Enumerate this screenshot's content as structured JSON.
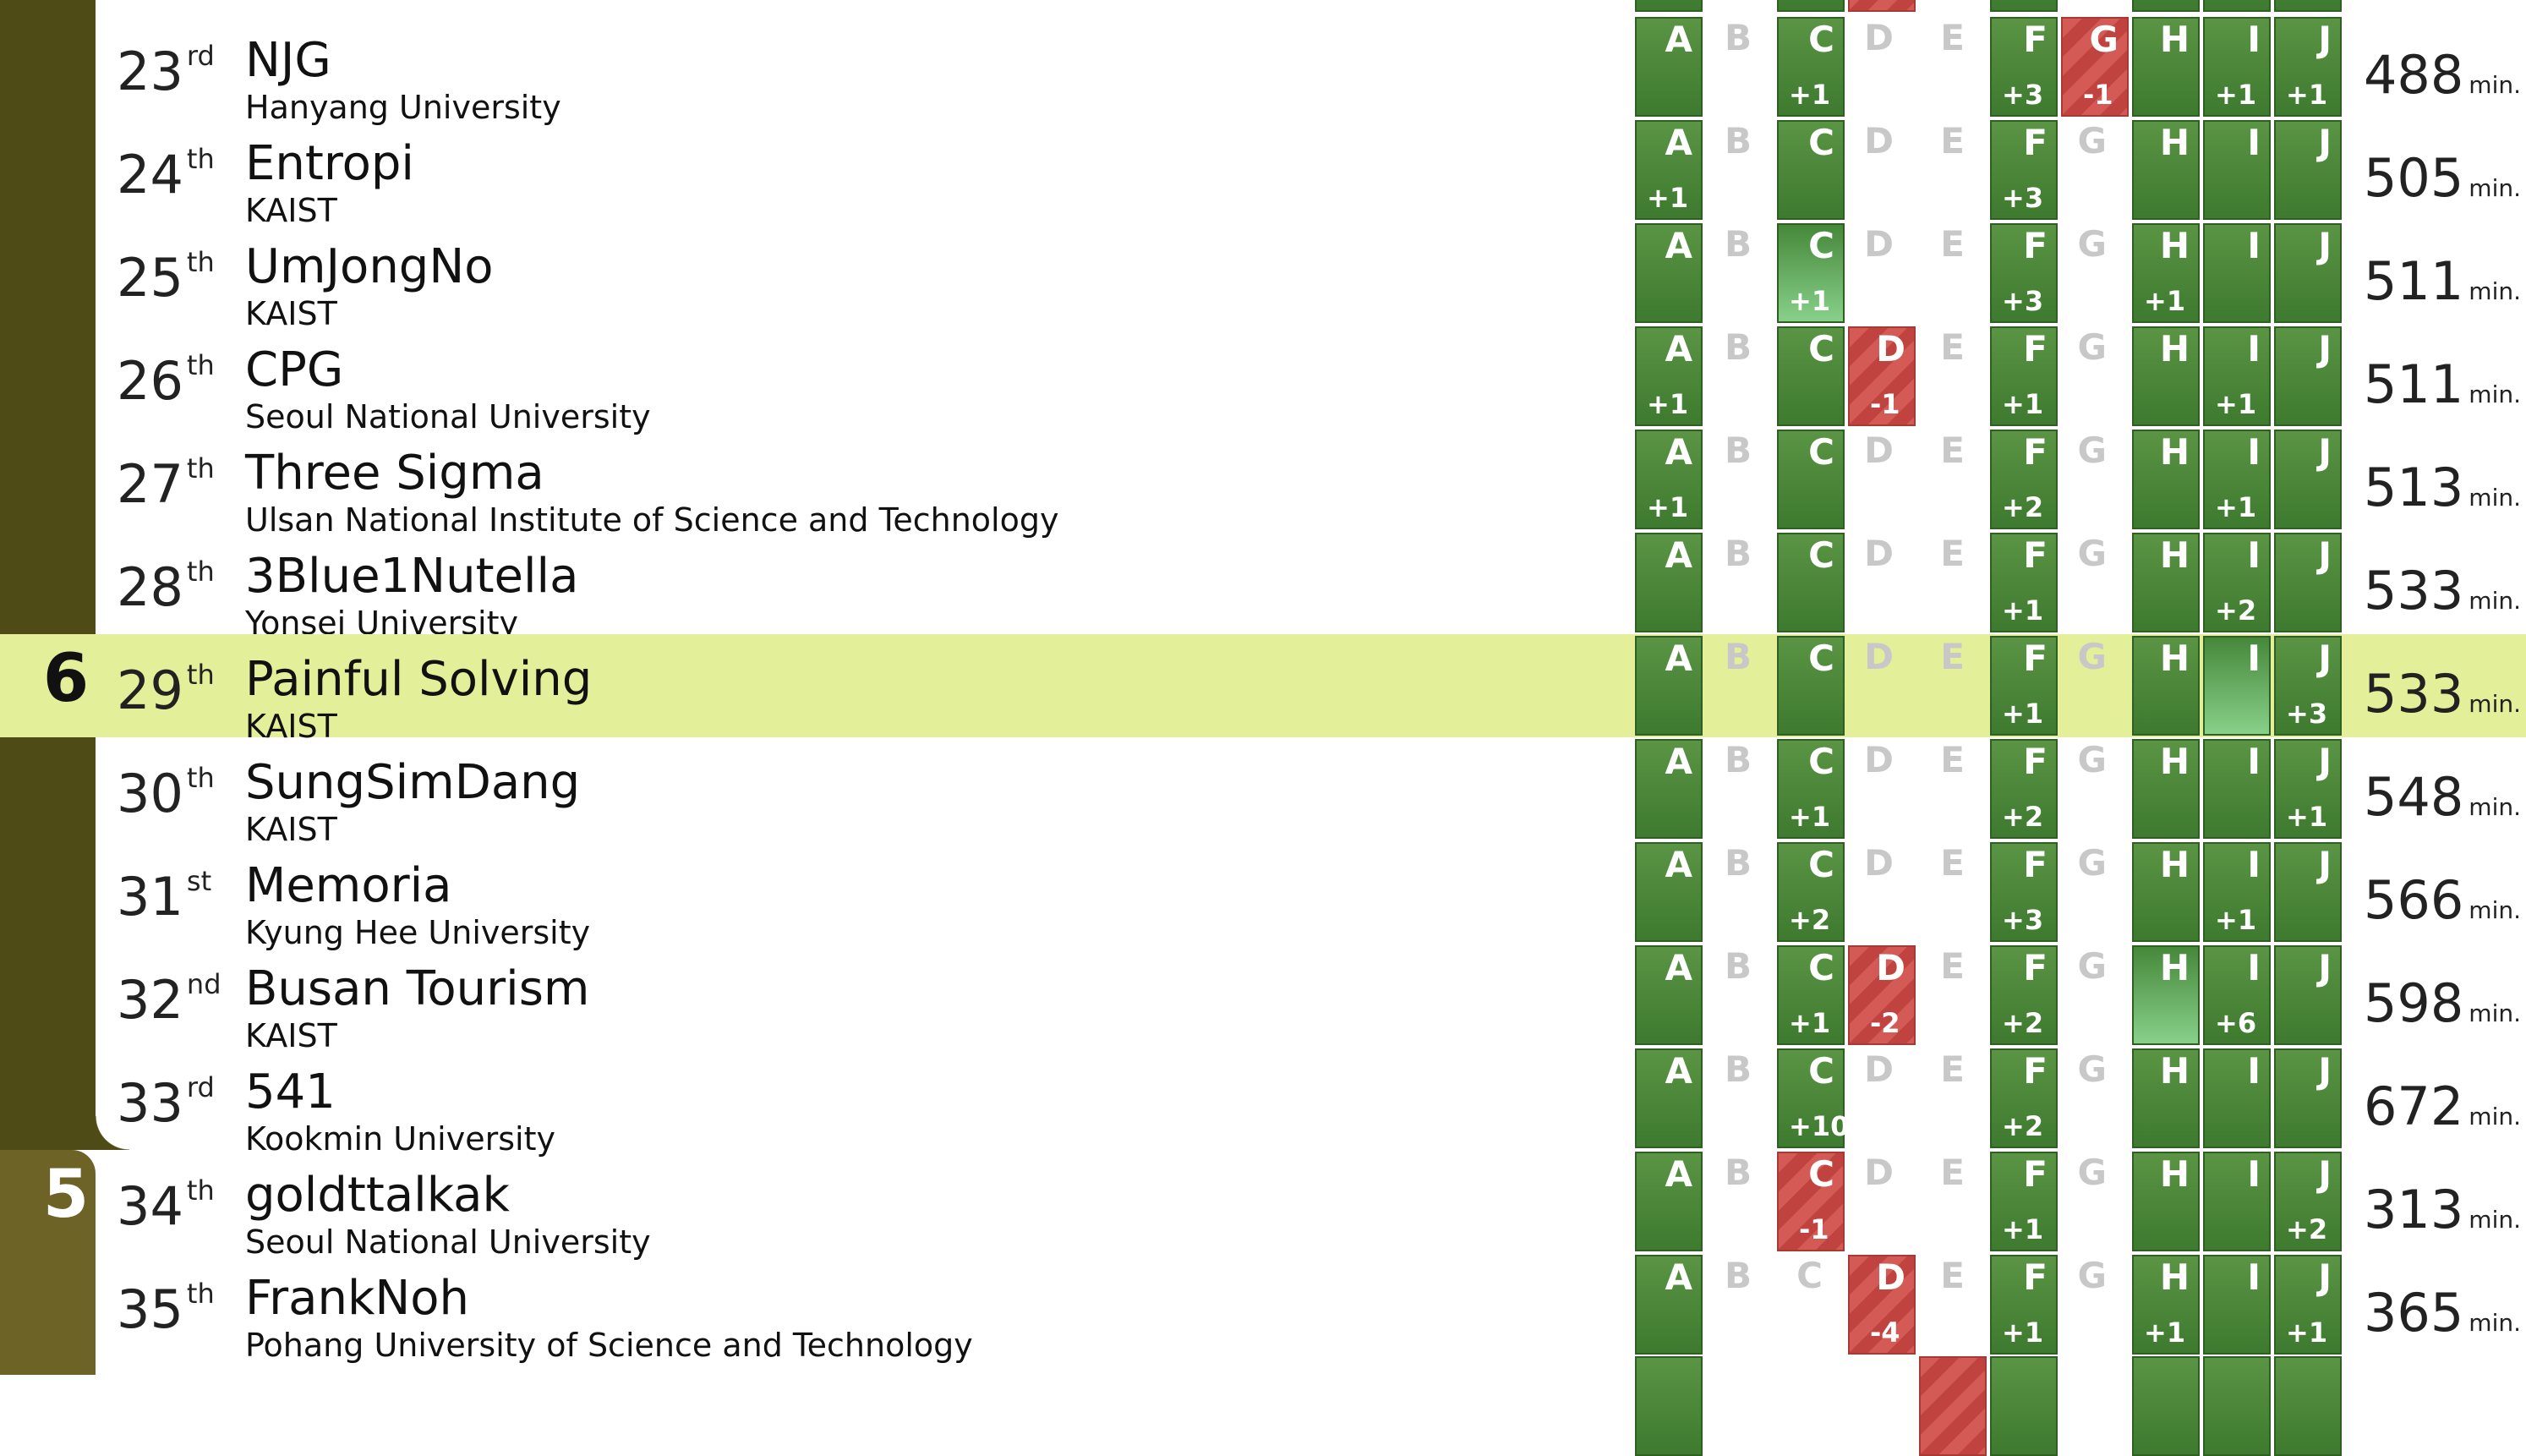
{
  "colors": {
    "tier6_bar": "#4f4b16",
    "tier5_bar": "#6e6326",
    "tier_label_light": "#ffffff",
    "tier_label_dark": "#111111",
    "solved_green": "#4e8a3c",
    "first_solve_green": "#88d08a",
    "failed_red": "#c9514c",
    "highlight_row": "#e4ef99"
  },
  "problems": [
    "A",
    "B",
    "C",
    "D",
    "E",
    "F",
    "G",
    "H",
    "I",
    "J"
  ],
  "time_unit": "min.",
  "tier_labels": [
    {
      "row_index": 6,
      "label": "6",
      "tier": "6"
    },
    {
      "row_index": 11,
      "label": "5",
      "tier": "5"
    }
  ],
  "rows": [
    {
      "rank": "23",
      "suffix": "rd",
      "team": "NJG",
      "university": "Hanyang University",
      "time": "488",
      "highlight": false,
      "tier": "6",
      "cells": [
        {
          "s": "solved",
          "t": ""
        },
        {
          "s": "none",
          "t": ""
        },
        {
          "s": "solved",
          "t": "+1"
        },
        {
          "s": "none",
          "t": ""
        },
        {
          "s": "none",
          "t": ""
        },
        {
          "s": "solved",
          "t": "+3"
        },
        {
          "s": "failed",
          "t": "-1"
        },
        {
          "s": "solved",
          "t": ""
        },
        {
          "s": "solved",
          "t": "+1"
        },
        {
          "s": "solved",
          "t": "+1"
        }
      ]
    },
    {
      "rank": "24",
      "suffix": "th",
      "team": "Entropi",
      "university": "KAIST",
      "time": "505",
      "highlight": false,
      "tier": "6",
      "cells": [
        {
          "s": "solved",
          "t": "+1"
        },
        {
          "s": "none",
          "t": ""
        },
        {
          "s": "solved",
          "t": ""
        },
        {
          "s": "none",
          "t": ""
        },
        {
          "s": "none",
          "t": ""
        },
        {
          "s": "solved",
          "t": "+3"
        },
        {
          "s": "none",
          "t": ""
        },
        {
          "s": "solved",
          "t": ""
        },
        {
          "s": "solved",
          "t": ""
        },
        {
          "s": "solved",
          "t": ""
        }
      ]
    },
    {
      "rank": "25",
      "suffix": "th",
      "team": "UmJongNo",
      "university": "KAIST",
      "time": "511",
      "highlight": false,
      "tier": "6",
      "cells": [
        {
          "s": "solved",
          "t": ""
        },
        {
          "s": "none",
          "t": ""
        },
        {
          "s": "first",
          "t": "+1"
        },
        {
          "s": "none",
          "t": ""
        },
        {
          "s": "none",
          "t": ""
        },
        {
          "s": "solved",
          "t": "+3"
        },
        {
          "s": "none",
          "t": ""
        },
        {
          "s": "solved",
          "t": "+1"
        },
        {
          "s": "solved",
          "t": ""
        },
        {
          "s": "solved",
          "t": ""
        }
      ]
    },
    {
      "rank": "26",
      "suffix": "th",
      "team": "CPG",
      "university": "Seoul National University",
      "time": "511",
      "highlight": false,
      "tier": "6",
      "cells": [
        {
          "s": "solved",
          "t": "+1"
        },
        {
          "s": "none",
          "t": ""
        },
        {
          "s": "solved",
          "t": ""
        },
        {
          "s": "failed",
          "t": "-1"
        },
        {
          "s": "none",
          "t": ""
        },
        {
          "s": "solved",
          "t": "+1"
        },
        {
          "s": "none",
          "t": ""
        },
        {
          "s": "solved",
          "t": ""
        },
        {
          "s": "solved",
          "t": "+1"
        },
        {
          "s": "solved",
          "t": ""
        }
      ]
    },
    {
      "rank": "27",
      "suffix": "th",
      "team": "Three Sigma",
      "university": "Ulsan National Institute of Science and Technology",
      "time": "513",
      "highlight": false,
      "tier": "6",
      "cells": [
        {
          "s": "solved",
          "t": "+1"
        },
        {
          "s": "none",
          "t": ""
        },
        {
          "s": "solved",
          "t": ""
        },
        {
          "s": "none",
          "t": ""
        },
        {
          "s": "none",
          "t": ""
        },
        {
          "s": "solved",
          "t": "+2"
        },
        {
          "s": "none",
          "t": ""
        },
        {
          "s": "solved",
          "t": ""
        },
        {
          "s": "solved",
          "t": "+1"
        },
        {
          "s": "solved",
          "t": ""
        }
      ]
    },
    {
      "rank": "28",
      "suffix": "th",
      "team": "3Blue1Nutella",
      "university": "Yonsei University",
      "time": "533",
      "highlight": false,
      "tier": "6",
      "cells": [
        {
          "s": "solved",
          "t": ""
        },
        {
          "s": "none",
          "t": ""
        },
        {
          "s": "solved",
          "t": ""
        },
        {
          "s": "none",
          "t": ""
        },
        {
          "s": "none",
          "t": ""
        },
        {
          "s": "solved",
          "t": "+1"
        },
        {
          "s": "none",
          "t": ""
        },
        {
          "s": "solved",
          "t": ""
        },
        {
          "s": "solved",
          "t": "+2"
        },
        {
          "s": "solved",
          "t": ""
        }
      ]
    },
    {
      "rank": "29",
      "suffix": "th",
      "team": "Painful Solving",
      "university": "KAIST",
      "time": "533",
      "highlight": true,
      "tier": "6",
      "cells": [
        {
          "s": "solved",
          "t": ""
        },
        {
          "s": "none",
          "t": ""
        },
        {
          "s": "solved",
          "t": ""
        },
        {
          "s": "none",
          "t": ""
        },
        {
          "s": "none",
          "t": ""
        },
        {
          "s": "solved",
          "t": "+1"
        },
        {
          "s": "none",
          "t": ""
        },
        {
          "s": "solved",
          "t": ""
        },
        {
          "s": "first",
          "t": ""
        },
        {
          "s": "solved",
          "t": "+3"
        }
      ]
    },
    {
      "rank": "30",
      "suffix": "th",
      "team": "SungSimDang",
      "university": "KAIST",
      "time": "548",
      "highlight": false,
      "tier": "6",
      "cells": [
        {
          "s": "solved",
          "t": ""
        },
        {
          "s": "none",
          "t": ""
        },
        {
          "s": "solved",
          "t": "+1"
        },
        {
          "s": "none",
          "t": ""
        },
        {
          "s": "none",
          "t": ""
        },
        {
          "s": "solved",
          "t": "+2"
        },
        {
          "s": "none",
          "t": ""
        },
        {
          "s": "solved",
          "t": ""
        },
        {
          "s": "solved",
          "t": ""
        },
        {
          "s": "solved",
          "t": "+1"
        }
      ]
    },
    {
      "rank": "31",
      "suffix": "st",
      "team": "Memoria",
      "university": "Kyung Hee University",
      "time": "566",
      "highlight": false,
      "tier": "6",
      "cells": [
        {
          "s": "solved",
          "t": ""
        },
        {
          "s": "none",
          "t": ""
        },
        {
          "s": "solved",
          "t": "+2"
        },
        {
          "s": "none",
          "t": ""
        },
        {
          "s": "none",
          "t": ""
        },
        {
          "s": "solved",
          "t": "+3"
        },
        {
          "s": "none",
          "t": ""
        },
        {
          "s": "solved",
          "t": ""
        },
        {
          "s": "solved",
          "t": "+1"
        },
        {
          "s": "solved",
          "t": ""
        }
      ]
    },
    {
      "rank": "32",
      "suffix": "nd",
      "team": "Busan Tourism",
      "university": "KAIST",
      "time": "598",
      "highlight": false,
      "tier": "6",
      "cells": [
        {
          "s": "solved",
          "t": ""
        },
        {
          "s": "none",
          "t": ""
        },
        {
          "s": "solved",
          "t": "+1"
        },
        {
          "s": "failed",
          "t": "-2"
        },
        {
          "s": "none",
          "t": ""
        },
        {
          "s": "solved",
          "t": "+2"
        },
        {
          "s": "none",
          "t": ""
        },
        {
          "s": "first",
          "t": ""
        },
        {
          "s": "solved",
          "t": "+6"
        },
        {
          "s": "solved",
          "t": ""
        }
      ]
    },
    {
      "rank": "33",
      "suffix": "rd",
      "team": "541",
      "university": "Kookmin University",
      "time": "672",
      "highlight": false,
      "tier": "6",
      "cells": [
        {
          "s": "solved",
          "t": ""
        },
        {
          "s": "none",
          "t": ""
        },
        {
          "s": "solved",
          "t": "+10"
        },
        {
          "s": "none",
          "t": ""
        },
        {
          "s": "none",
          "t": ""
        },
        {
          "s": "solved",
          "t": "+2"
        },
        {
          "s": "none",
          "t": ""
        },
        {
          "s": "solved",
          "t": ""
        },
        {
          "s": "solved",
          "t": ""
        },
        {
          "s": "solved",
          "t": ""
        }
      ]
    },
    {
      "rank": "34",
      "suffix": "th",
      "team": "goldttalkak",
      "university": "Seoul National University",
      "time": "313",
      "highlight": false,
      "tier": "5",
      "cells": [
        {
          "s": "solved",
          "t": ""
        },
        {
          "s": "none",
          "t": ""
        },
        {
          "s": "failed",
          "t": "-1"
        },
        {
          "s": "none",
          "t": ""
        },
        {
          "s": "none",
          "t": ""
        },
        {
          "s": "solved",
          "t": "+1"
        },
        {
          "s": "none",
          "t": ""
        },
        {
          "s": "solved",
          "t": ""
        },
        {
          "s": "solved",
          "t": ""
        },
        {
          "s": "solved",
          "t": "+2"
        }
      ]
    },
    {
      "rank": "35",
      "suffix": "th",
      "team": "FrankNoh",
      "university": "Pohang University of Science and Technology",
      "time": "365",
      "highlight": false,
      "tier": "5",
      "cells": [
        {
          "s": "solved",
          "t": ""
        },
        {
          "s": "none",
          "t": ""
        },
        {
          "s": "none",
          "t": ""
        },
        {
          "s": "failed",
          "t": "-4"
        },
        {
          "s": "none",
          "t": ""
        },
        {
          "s": "solved",
          "t": "+1"
        },
        {
          "s": "none",
          "t": ""
        },
        {
          "s": "solved",
          "t": "+1"
        },
        {
          "s": "solved",
          "t": ""
        },
        {
          "s": "solved",
          "t": "+1"
        }
      ]
    }
  ]
}
